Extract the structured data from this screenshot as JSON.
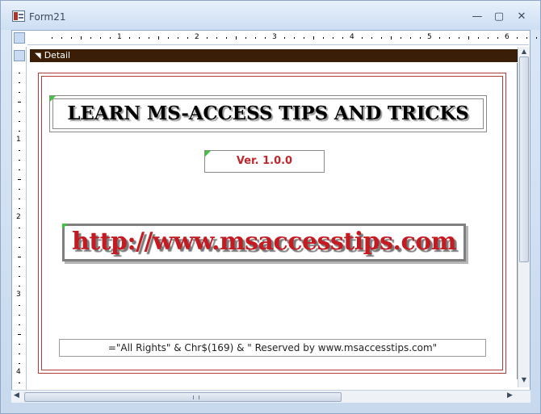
{
  "window": {
    "title": "Form21",
    "minimize_glyph": "—",
    "maximize_glyph": "▢",
    "close_glyph": "✕",
    "app_icon": "form-icon"
  },
  "ruler": {
    "top_numbers": [
      "1",
      "2",
      "3",
      "4",
      "5",
      "6"
    ],
    "left_numbers": [
      "1",
      "2",
      "3",
      "4"
    ]
  },
  "section": {
    "label": "Detail",
    "icon_glyph": "◥"
  },
  "controls": {
    "title_text": "LEARN MS-ACCESS TIPS AND TRICKS",
    "version_text": "Ver. 1.0.0",
    "url_text": "http://www.msaccesstips.com",
    "rights_expression": "=\"All Rights\" & Chr$(169) & \" Reserved by www.msaccesstips.com\""
  },
  "colors": {
    "section_bar": "#3a1e08",
    "frame_line": "#b33a3a",
    "version_text": "#c0262b",
    "url_text": "#c41a22",
    "selection_marker": "#3cc43c"
  },
  "scrollbars": {
    "up_arrow": "▲",
    "down_arrow": "▼",
    "left_arrow": "◀",
    "right_arrow": "▶"
  }
}
